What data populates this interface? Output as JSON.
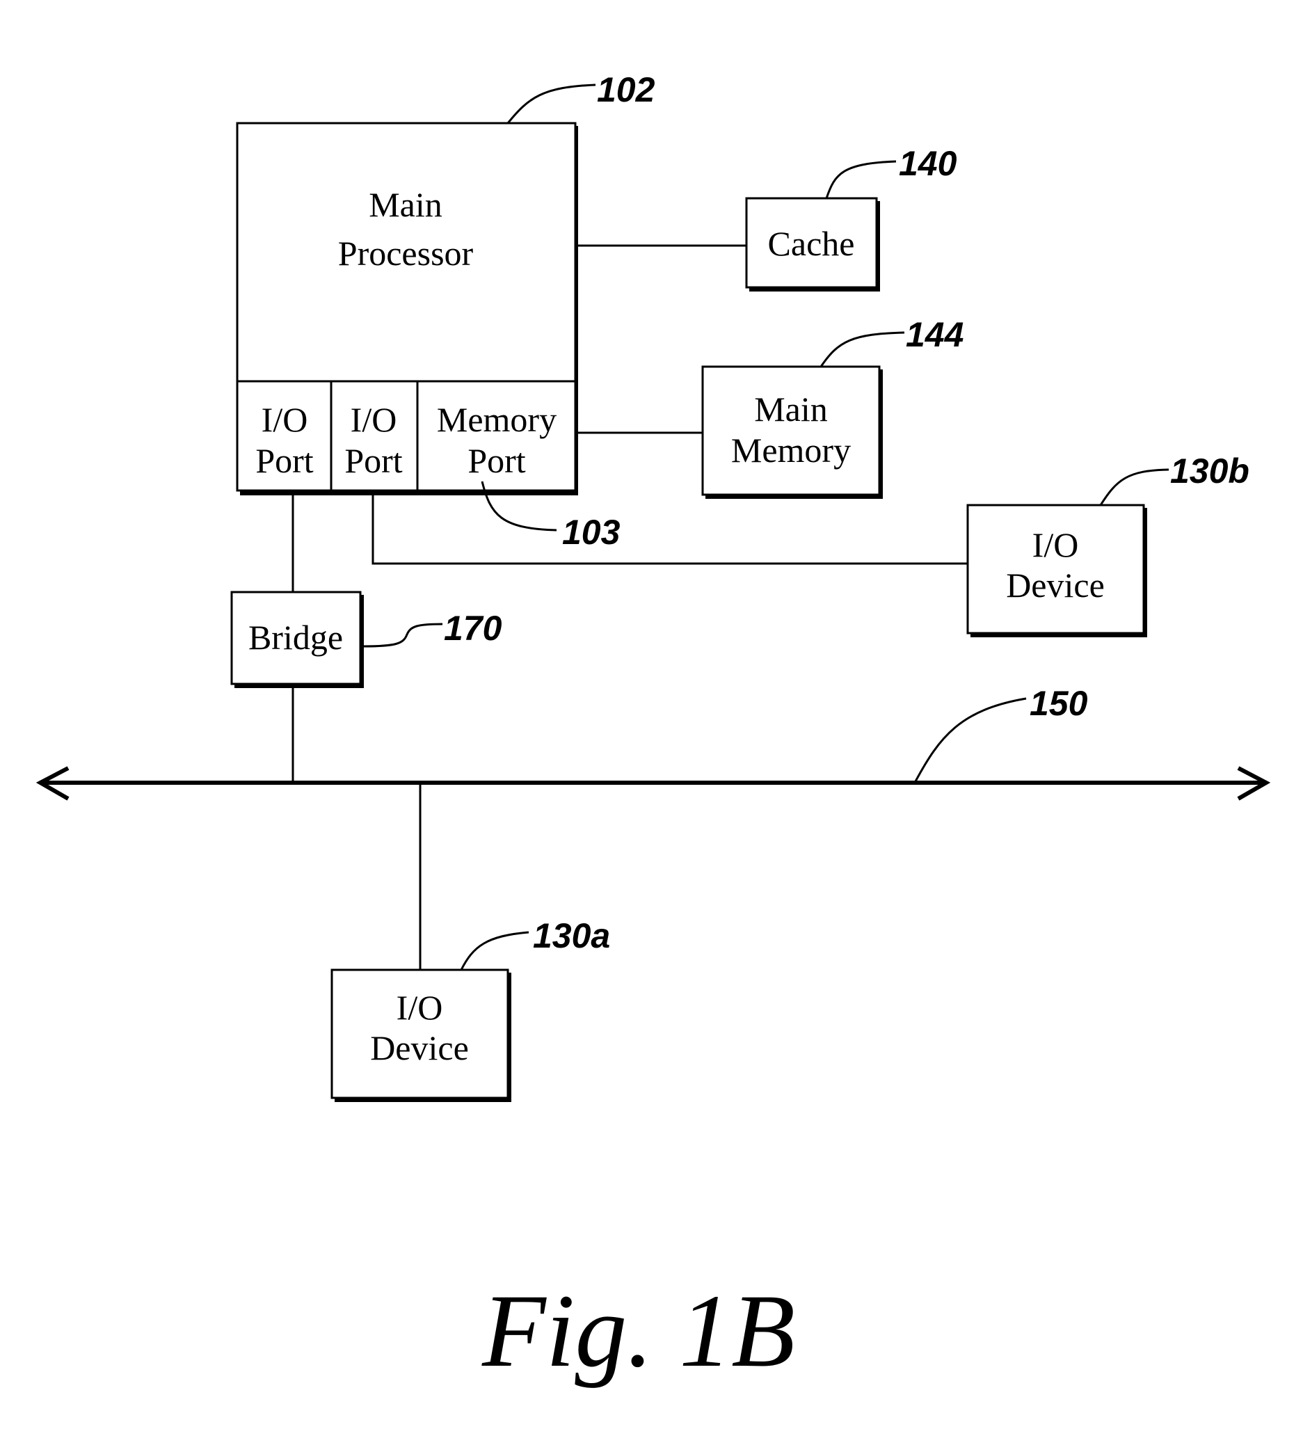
{
  "figure": {
    "caption": "Fig. 1B"
  },
  "blocks": {
    "main_processor": {
      "ref": "102",
      "line1": "Main",
      "line2": "Processor"
    },
    "io_port_1": {
      "line1": "I/O",
      "line2": "Port"
    },
    "io_port_2": {
      "line1": "I/O",
      "line2": "Port"
    },
    "memory_port": {
      "ref": "103",
      "line1": "Memory",
      "line2": "Port"
    },
    "cache": {
      "ref": "140",
      "label": "Cache"
    },
    "main_memory": {
      "ref": "144",
      "line1": "Main",
      "line2": "Memory"
    },
    "io_device_b": {
      "ref": "130b",
      "line1": "I/O",
      "line2": "Device"
    },
    "bridge": {
      "ref": "170",
      "label": "Bridge"
    },
    "bus": {
      "ref": "150"
    },
    "io_device_a": {
      "ref": "130a",
      "line1": "I/O",
      "line2": "Device"
    }
  }
}
